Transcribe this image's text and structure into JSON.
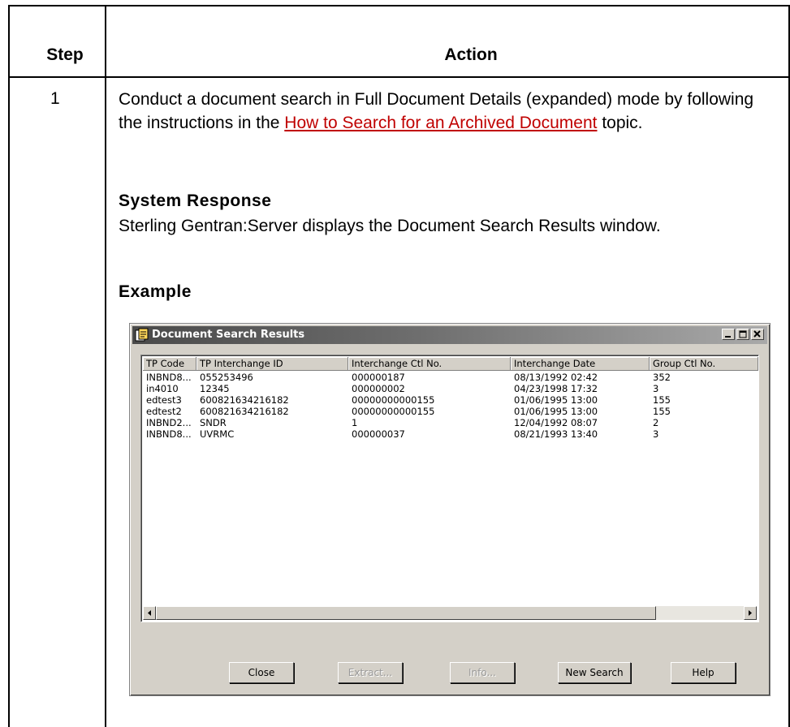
{
  "table": {
    "header_step": "Step",
    "header_action": "Action",
    "step_number": "1"
  },
  "instruction": {
    "text_before": "Conduct a document search in Full Document Details (expanded) mode by following the instructions in the ",
    "link_text": "How to Search for an Archived Document",
    "text_after": " topic."
  },
  "system_response": {
    "heading": "System Response",
    "text": "Sterling Gentran:Server displays the Document Search Results window."
  },
  "example": {
    "heading": "Example"
  },
  "window": {
    "title": "Document Search Results",
    "columns": [
      "TP Code",
      "TP Interchange ID",
      "Interchange Ctl No.",
      "Interchange Date",
      "Group Ctl No."
    ],
    "rows": [
      [
        "INBND8...",
        "055253496",
        "000000187",
        "08/13/1992 02:42",
        "352"
      ],
      [
        "in4010",
        "12345",
        "000000002",
        "04/23/1998 17:32",
        "3"
      ],
      [
        "edtest3",
        "600821634216182",
        "00000000000155",
        "01/06/1995 13:00",
        "155"
      ],
      [
        "edtest2",
        "600821634216182",
        "00000000000155",
        "01/06/1995 13:00",
        "155"
      ],
      [
        "INBND2...",
        "SNDR",
        "1",
        "12/04/1992 08:07",
        "2"
      ],
      [
        "INBND8...",
        "UVRMC",
        "000000037",
        "08/21/1993 13:40",
        "3"
      ]
    ],
    "buttons": {
      "close": "Close",
      "extract": "Extract...",
      "info": "Info...",
      "new_search": "New Search",
      "help": "Help"
    }
  },
  "colors": {
    "link": "#c00000",
    "window_face": "#d4d0c8"
  }
}
